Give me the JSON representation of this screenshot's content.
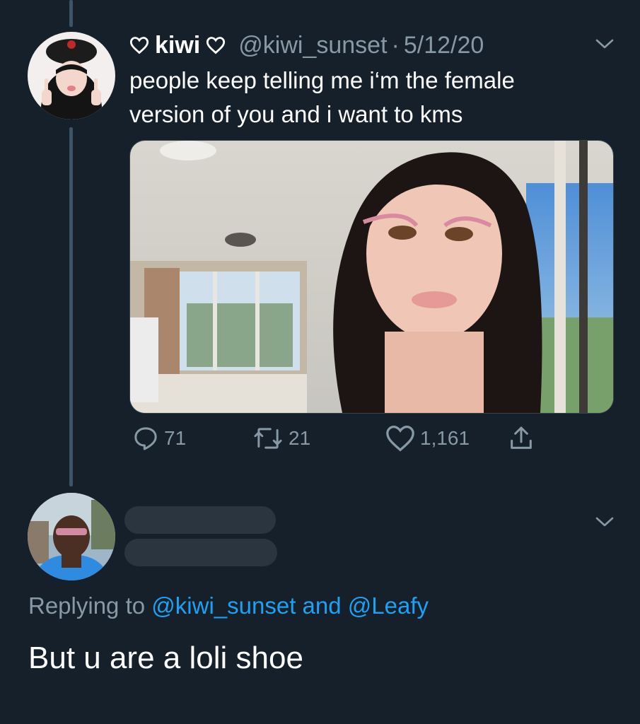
{
  "tweet": {
    "display_name": "kiwi",
    "handle": "@kiwi_sunset",
    "separator": "·",
    "date": "5/12/20",
    "text_line1": "people keep telling me i‘m the female",
    "text_line2": "version of you and i want to kms",
    "reply_count": "71",
    "retweet_count": "21",
    "like_count": "1,161"
  },
  "reply": {
    "replying_prefix": "Replying to",
    "mention1": "@kiwi_sunset",
    "conjunction": "and",
    "mention2": "@Leafy",
    "text": "But u are a loli shoe"
  },
  "colors": {
    "background": "#15202b",
    "secondary_text": "#8899a6",
    "link": "#1da1f2",
    "thread_line": "#3d5466"
  }
}
